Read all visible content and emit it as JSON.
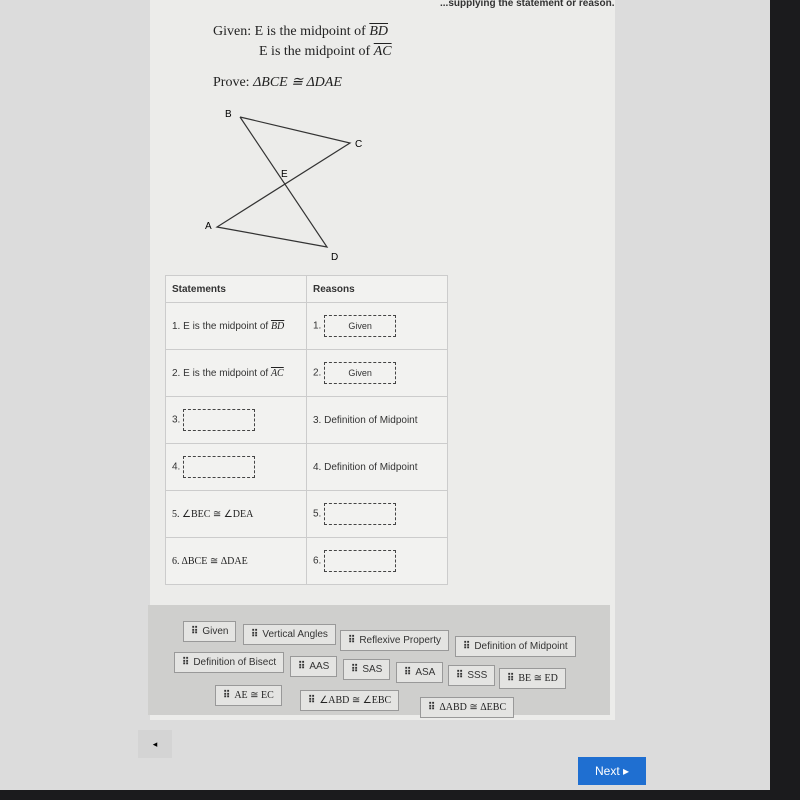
{
  "instructions": "...supplying the statement or reason.",
  "given": {
    "label": "Given:",
    "line1": "E is the midpoint of ",
    "seg1": "BD",
    "line2": "E is the midpoint of ",
    "seg2": "AC"
  },
  "prove": {
    "label": "Prove:",
    "statement": "ΔBCE ≅ ΔDAE"
  },
  "diagram": {
    "labels": [
      "B",
      "C",
      "E",
      "A",
      "D"
    ]
  },
  "table": {
    "headers": [
      "Statements",
      "Reasons"
    ],
    "rows": [
      {
        "num": "1.",
        "statement": "1. E is the midpoint of ",
        "seg": "BD",
        "reason": "Given",
        "reason_num": "1."
      },
      {
        "num": "2.",
        "statement": "2. E is the midpoint of ",
        "seg": "AC",
        "reason": "Given",
        "reason_num": "2."
      },
      {
        "num": "3.",
        "statement": "",
        "reason": "3. Definition of Midpoint"
      },
      {
        "num": "4.",
        "statement": "",
        "reason": "4. Definition of Midpoint"
      },
      {
        "statement": "5. ∠BEC ≅ ∠DEA",
        "reason_num": "5.",
        "reason": ""
      },
      {
        "statement": "6. ΔBCE ≅ ΔDAE",
        "reason_num": "6.",
        "reason": ""
      }
    ]
  },
  "tiles": [
    "Given",
    "Vertical Angles",
    "Reflexive Property",
    "Definition of Midpoint",
    "Definition of Bisect",
    "AAS",
    "SAS",
    "ASA",
    "SSS",
    "BE ≅ ED",
    "AE ≅ EC",
    "∠ABD ≅ ∠EBC",
    "ΔABD ≅ ΔEBC"
  ],
  "nav": {
    "back": "◂",
    "next": "Next ▸"
  },
  "colors": {
    "next": "#1f6fd1"
  }
}
